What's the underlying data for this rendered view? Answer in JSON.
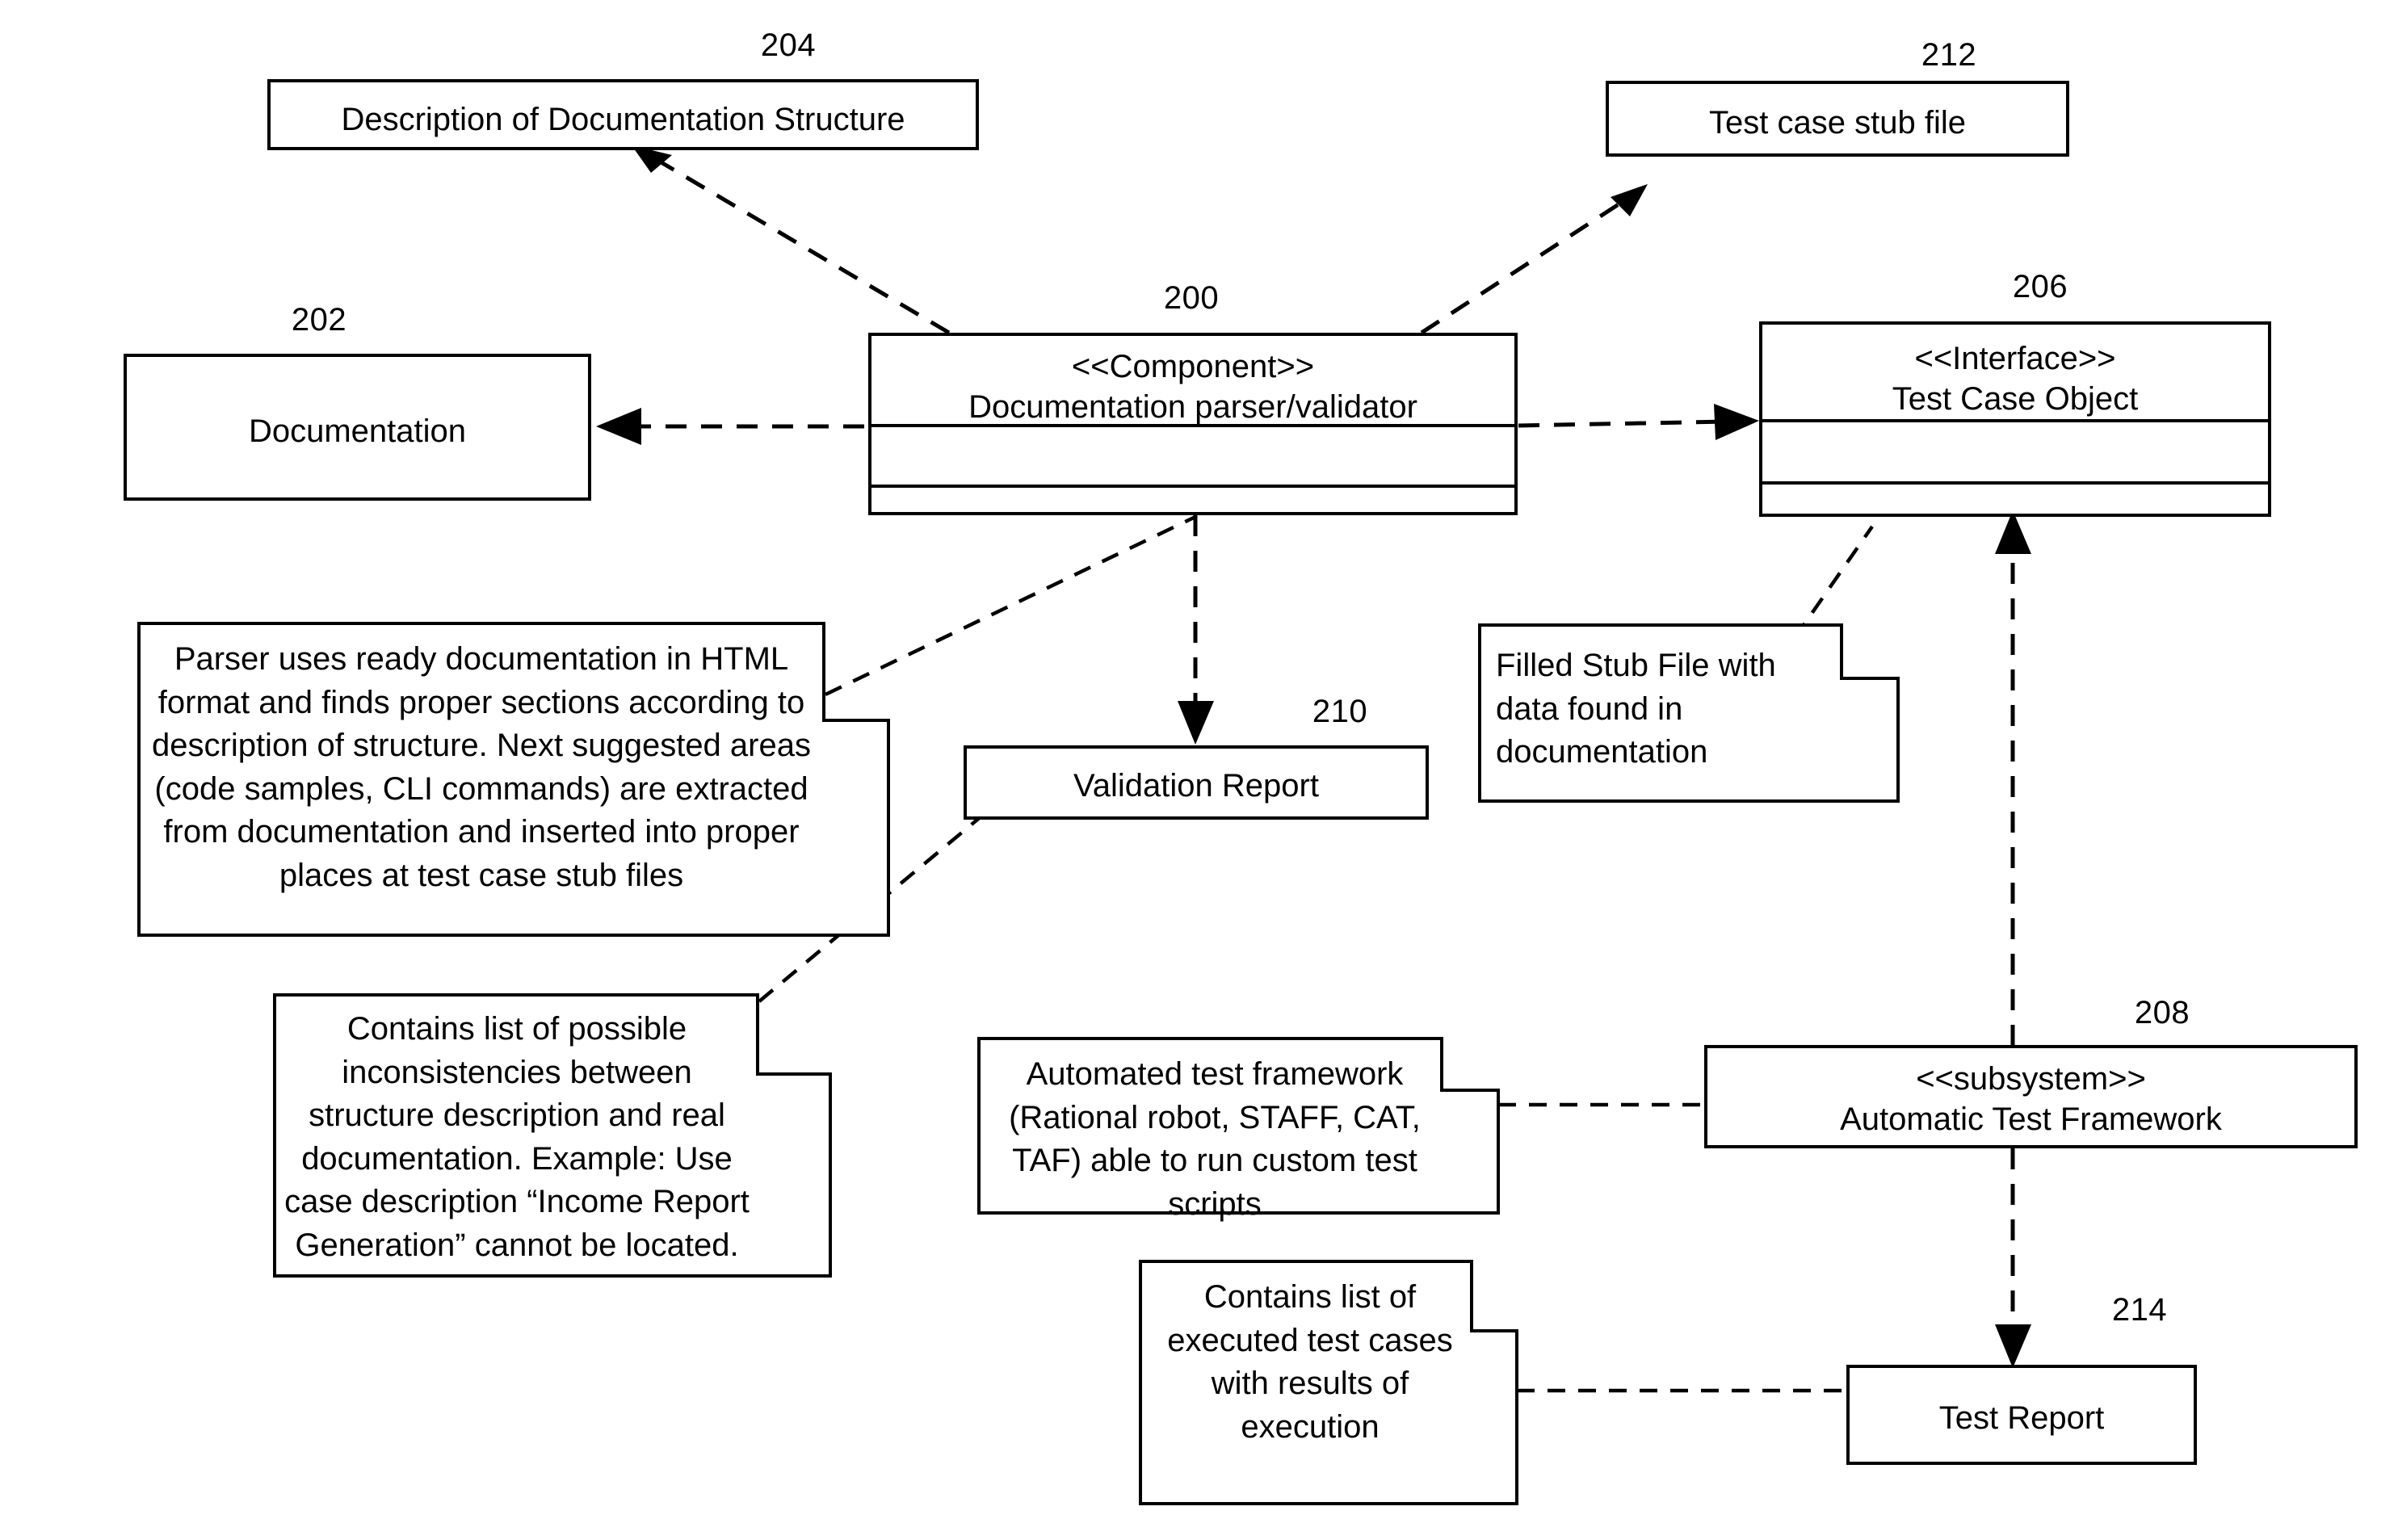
{
  "diagram": {
    "title": "Documentation parser/validator component diagram",
    "background_color": "#ffffff",
    "line_color": "#000000",
    "boxes": [
      {
        "id": "204",
        "ref": "204",
        "name": "description-of-documentation-structure",
        "label": "Description of Documentation Structure",
        "kind": "artifact"
      },
      {
        "id": "202",
        "ref": "202",
        "name": "documentation",
        "label": "Documentation",
        "kind": "artifact"
      },
      {
        "id": "200",
        "ref": "200",
        "name": "documentation-parser-validator",
        "stereotype": "<<Component>>",
        "label": "Documentation parser/validator",
        "kind": "component"
      },
      {
        "id": "212",
        "ref": "212",
        "name": "test-case-stub-file",
        "label": "Test case stub file",
        "kind": "artifact"
      },
      {
        "id": "206",
        "ref": "206",
        "name": "test-case-object",
        "stereotype": "<<Interface>>",
        "label": "Test Case Object",
        "kind": "interface"
      },
      {
        "id": "210",
        "ref": "210",
        "name": "validation-report",
        "label": "Validation Report",
        "kind": "artifact"
      },
      {
        "id": "208",
        "ref": "208",
        "name": "automatic-test-framework",
        "stereotype": "<<subsystem>>",
        "label": "Automatic Test Framework",
        "kind": "subsystem"
      },
      {
        "id": "214",
        "ref": "214",
        "name": "test-report",
        "label": "Test Report",
        "kind": "artifact"
      }
    ],
    "notes": [
      {
        "id": "note-parser",
        "name": "note-parser-behavior",
        "text": "Parser uses ready documentation in HTML format and finds proper sections according to description of structure.  Next suggested areas (code samples, CLI commands) are extracted from documentation and inserted into proper places at test case stub files",
        "attached_to": "200"
      },
      {
        "id": "note-validation",
        "name": "note-validation-report-contents",
        "text": "Contains list of possible inconsistencies between structure description and real documentation.  Example:  Use case description “Income Report Generation” cannot be located.",
        "attached_to": "210"
      },
      {
        "id": "note-filled-stub",
        "name": "note-filled-stub-file",
        "text": "Filled Stub File with data found in documentation",
        "attached_to": "206"
      },
      {
        "id": "note-framework",
        "name": "note-automated-test-framework",
        "text": "Automated test framework (Rational robot, STAFF, CAT, TAF) able to run custom test scripts",
        "attached_to": "208"
      },
      {
        "id": "note-test-report",
        "name": "note-test-report-contents",
        "text": "Contains list of executed test cases with results of execution",
        "attached_to": "214"
      }
    ],
    "connections": [
      {
        "name": "conn-parser-to-description",
        "from": "200",
        "to": "204",
        "style": "dashed",
        "arrow": "open-filled"
      },
      {
        "name": "conn-parser-to-stub-file",
        "from": "200",
        "to": "212",
        "style": "dashed",
        "arrow": "open-filled"
      },
      {
        "name": "conn-parser-to-documentation",
        "from": "200",
        "to": "202",
        "style": "dashed",
        "arrow": "open-filled"
      },
      {
        "name": "conn-parser-to-test-case-object",
        "from": "200",
        "to": "206",
        "style": "dashed",
        "arrow": "open-filled"
      },
      {
        "name": "conn-parser-to-validation-report",
        "from": "200",
        "to": "210",
        "style": "dashed",
        "arrow": "open-filled"
      },
      {
        "name": "conn-framework-to-test-case-object",
        "from": "208",
        "to": "206",
        "style": "dashed",
        "arrow": "open-filled"
      },
      {
        "name": "conn-framework-to-test-report",
        "from": "208",
        "to": "214",
        "style": "dashed",
        "arrow": "open-filled"
      },
      {
        "name": "conn-note-parser-anchor",
        "from": "note-parser",
        "to": "200",
        "style": "dashed",
        "arrow": "none"
      },
      {
        "name": "conn-note-validation-anchor",
        "from": "note-validation",
        "to": "210",
        "style": "dashed",
        "arrow": "none"
      },
      {
        "name": "conn-note-filled-stub-anchor",
        "from": "note-filled-stub",
        "to": "206",
        "style": "dashed",
        "arrow": "none"
      },
      {
        "name": "conn-note-framework-anchor",
        "from": "note-framework",
        "to": "208",
        "style": "dashed",
        "arrow": "none"
      },
      {
        "name": "conn-note-test-report-anchor",
        "from": "note-test-report",
        "to": "214",
        "style": "dashed",
        "arrow": "none"
      }
    ]
  }
}
